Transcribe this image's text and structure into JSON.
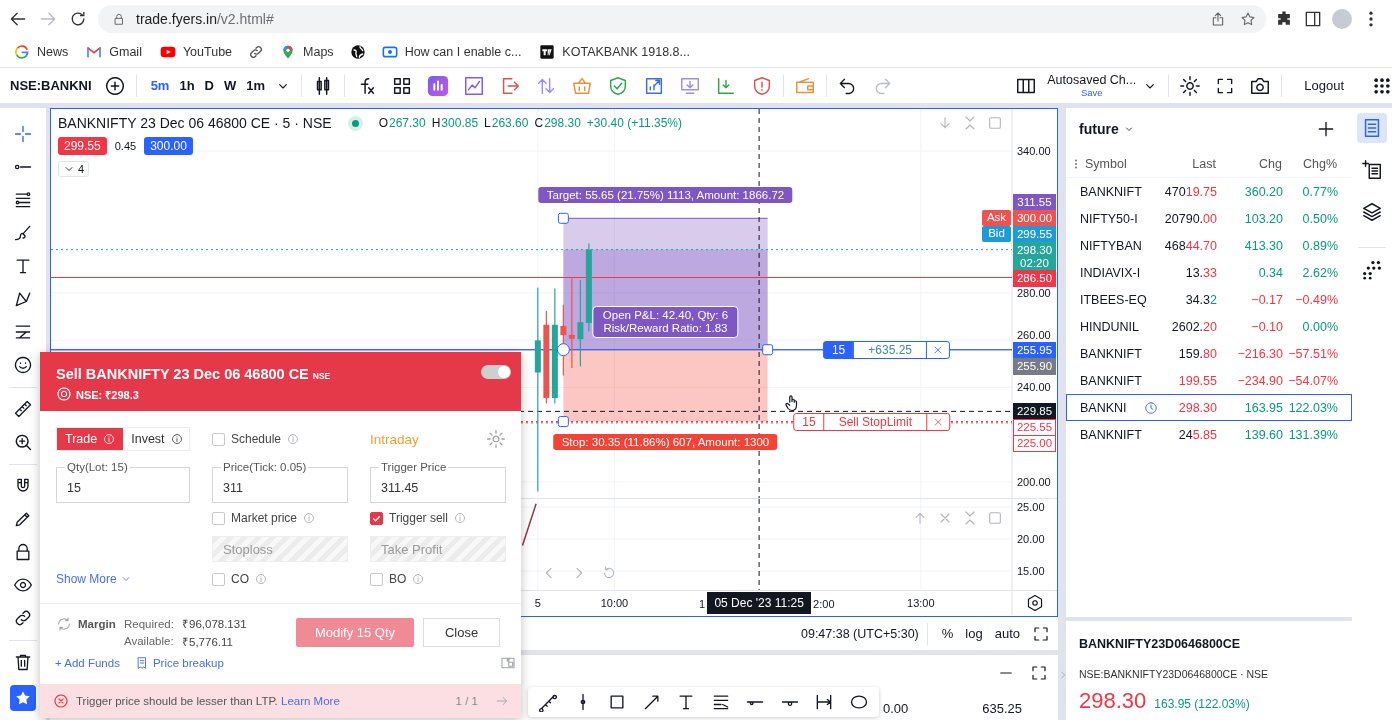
{
  "browser": {
    "url_host": "trade.fyers.in",
    "url_path": "/v2.html#",
    "bookmarks": [
      {
        "label": "News"
      },
      {
        "label": "Gmail"
      },
      {
        "label": "YouTube"
      },
      {
        "label": "Maps"
      },
      {
        "label": "How can I enable c..."
      },
      {
        "label": "KOTAKBANK 1918.8..."
      }
    ]
  },
  "toolbar": {
    "symbol": "NSE:BANKNI",
    "intervals": [
      {
        "label": "5m",
        "selected": true
      },
      {
        "label": "1h",
        "selected": false
      },
      {
        "label": "D",
        "selected": false
      },
      {
        "label": "W",
        "selected": false
      },
      {
        "label": "1m",
        "selected": false
      }
    ],
    "layout_name": "Autosaved Ch...",
    "save": "Save",
    "logout": "Logout"
  },
  "left_tools": [
    {
      "selected": true
    },
    {
      "selected": false
    },
    {
      "selected": false
    },
    {
      "selected": false
    },
    {
      "selected": false
    },
    {
      "selected": false
    },
    {
      "selected": false
    },
    {
      "selected": false
    },
    {
      "selected": false
    },
    {
      "selected": false
    },
    {
      "selected": false
    },
    {
      "selected": false
    },
    {
      "selected": false
    },
    {
      "selected": false
    },
    {
      "selected": false
    },
    {
      "selected": false
    },
    {
      "selected": true
    }
  ],
  "chart": {
    "title": "BANKNIFTY 23 Dec 06 46800 CE · 5 · NSE",
    "legend": [
      {
        "key": "O",
        "value": "267.30"
      },
      {
        "key": "H",
        "value": "300.85"
      },
      {
        "key": "L",
        "value": "263.60"
      },
      {
        "key": "C",
        "value": "298.30"
      }
    ],
    "change": "+30.40 (+11.35%)",
    "sell_price": "299.55",
    "spread": "0.45",
    "buy_price": "300.00",
    "indicator_count": "4",
    "price_tags": [
      {
        "kind": "filled"
      },
      {
        "kind": "filled",
        "second_line": "02:20"
      },
      {
        "kind": "filled"
      },
      {
        "kind": "filled",
        "order": {
          "qty": "15",
          "text": "+635.25"
        }
      },
      {
        "kind": "filled"
      },
      {
        "kind": "filled"
      },
      {
        "kind": "outline",
        "order": {
          "qty": "15",
          "text": "Sell StopLimit"
        }
      },
      {
        "kind": "outline"
      }
    ],
    "quote_tags": [
      {
        "label": "300.00",
        "side_label": "Ask",
        "color": "#ef5350"
      },
      {
        "label": "299.55",
        "side_label": "Bid",
        "color": "#1e9ad6"
      }
    ],
    "covered_time_labels": [
      "1",
      "2:00"
    ],
    "chart_data": [
      {
        "type": "candlestick",
        "x": [
          "2023-12-05T09:15",
          "2023-12-05T09:20",
          "2023-12-05T09:25",
          "2023-12-05T09:30",
          "2023-12-05T09:35",
          "2023-12-05T09:40",
          "2023-12-05T09:45"
        ],
        "ohlc": [
          [
            246.3,
            282.2,
            196,
            259.9
          ],
          [
            266.5,
            272.3,
            233.2,
            235.5
          ],
          [
            235.5,
            281.8,
            233.2,
            266.5
          ],
          [
            266,
            275,
            245,
            262.1
          ],
          [
            262.2,
            286.2,
            248.2,
            260.6
          ],
          [
            260.4,
            285.4,
            249,
            267.6
          ],
          [
            267.3,
            300.85,
            263.6,
            298.3
          ]
        ],
        "xlim": [
          "2023-12-05T04:29",
          "2023-12-05T14:20"
        ],
        "ylim": [
          193.2,
          357.8
        ],
        "tick_labels": "y",
        "grid": true,
        "yticks": [
          {
            "value": 340,
            "label": "340.00"
          },
          {
            "value": 280,
            "label": "280.00"
          },
          {
            "value": 260,
            "label": "260.00"
          },
          {
            "value": 240,
            "label": "240.00"
          },
          {
            "value": 200,
            "label": "200.00"
          }
        ],
        "ref_lines": [
          {
            "axis": "y",
            "value": 311.55,
            "label": "311.55",
            "color": "#7e57c2",
            "line_style": "solid"
          },
          {
            "axis": "y",
            "value": 298.3,
            "label": "298.30",
            "color": "#26a69a",
            "line_style": "dotted"
          },
          {
            "axis": "y",
            "value": 286.5,
            "label": "286.50",
            "color": "#f23645",
            "line_style": "solid"
          },
          {
            "axis": "y",
            "value": 255.95,
            "label": "255.95",
            "color": "#2962ff",
            "line_style": "solid"
          },
          {
            "axis": "y",
            "value": 255.9,
            "label": "255.90",
            "color": "#787b86",
            "line_style": "solid"
          },
          {
            "axis": "y",
            "value": 229.85,
            "label": "229.85",
            "color": "#131722",
            "line_style": "dashed"
          },
          {
            "axis": "y",
            "value": 225.55,
            "label": "225.55",
            "color": "#f23645",
            "line_style": "dotted"
          },
          {
            "axis": "y",
            "value": 225,
            "label": "225.00",
            "color": "#f23645",
            "line_style": "dotted"
          },
          {
            "axis": "x",
            "value": "2023-12-05T11:25",
            "color": "#131722",
            "line_style": "dashed"
          }
        ],
        "bands": [
          {
            "axis": "y",
            "from": 255.95,
            "to": 311.55,
            "label": "Target: 55.65 (21.75%) 1113, Amount: 1866.72",
            "color": "#7e57c2"
          },
          {
            "axis": "y",
            "from": 225.55,
            "to": 255.95,
            "label": "Stop: 30.35 (11.86%) 607, Amount: 1300",
            "color": "#f44336"
          }
        ],
        "annotations": [
          "Open P&L: 42.40, Qty: 6",
          "Risk/Reward Ratio: 1.83"
        ]
      },
      {
        "type": "line",
        "x": [
          "2023-12-05T09:06",
          "2023-12-05T09:14"
        ],
        "values": [
          19,
          25.5
        ],
        "color": "#8d3a4a",
        "xlim": [
          "2023-12-05T04:29",
          "2023-12-05T14:20"
        ],
        "ylim": [
          12.2,
          26.25
        ],
        "grid": true,
        "yticks": [
          {
            "value": 25,
            "label": "25.00"
          },
          {
            "value": 20,
            "label": "20.00"
          },
          {
            "value": 15,
            "label": "15.00"
          }
        ],
        "xticks": [
          {
            "value": "2023-12-05T09:15",
            "label": "5"
          },
          {
            "value": "2023-12-05T10:00",
            "label": "10:00"
          },
          {
            "value": "2023-12-05T13:00",
            "label": "13:00"
          }
        ],
        "ref_lines": [
          {
            "axis": "x",
            "value": "2023-12-05T11:25",
            "label": "05 Dec '23 11:25",
            "color": "#131722",
            "line_style": "dashed"
          }
        ]
      }
    ]
  },
  "chart_footer": {
    "time": "09:47:38 (UTC+5:30)",
    "percent": "%",
    "log": "log",
    "auto": "auto"
  },
  "bottom_panel": {
    "values": [
      "0.00",
      "635.25"
    ]
  },
  "order_ticket": {
    "title": "Sell BANKNIFTY 23 Dec 06 46800 CE",
    "exchange": "NSE",
    "ltp": "NSE: ₹298.3",
    "toggle": {
      "on": true
    },
    "modes": [
      {
        "label": "Trade",
        "selected": true
      },
      {
        "label": "Invest",
        "selected": false
      }
    ],
    "schedule": {
      "label": "Schedule",
      "checked": false
    },
    "product": "Intraday",
    "fields": [
      {
        "label": "Qty(Lot: 15)",
        "value": "15"
      },
      {
        "label": "Price(Tick: 0.05)",
        "value": "311"
      },
      {
        "label": "Trigger Price",
        "value": "311.45"
      }
    ],
    "options": [
      {
        "label": "Market price",
        "checked": false
      },
      {
        "label": "Trigger sell",
        "checked": true
      }
    ],
    "exit_fields": [
      {
        "placeholder": "Stoploss",
        "disabled": true
      },
      {
        "placeholder": "Take Profit",
        "disabled": true
      }
    ],
    "show_more": "Show More",
    "order_types": [
      {
        "label": "CO",
        "checked": false
      },
      {
        "label": "BO",
        "checked": false
      }
    ],
    "margin": {
      "label": "Margin",
      "required_label": "Required:",
      "required": "₹96,078.131",
      "available_label": "Available:",
      "available": "₹5,776.11"
    },
    "submit": {
      "label": "Modify 15 Qty",
      "disabled": true
    },
    "close": "Close",
    "add_funds": "+ Add Funds",
    "price_breakup": "Price breakup",
    "error": {
      "text": "Trigger price should be lesser than LTP.",
      "link": "Learn More",
      "counter": "1 / 1"
    }
  },
  "watchlist": {
    "name": "future",
    "columns": [
      "Symbol",
      "Last",
      "Chg",
      "Chg%"
    ],
    "rows": [
      {
        "symbol": "BANKNIFT",
        "last": "470",
        "last_tick": "19.75",
        "tick_up": false,
        "chg": "360.20",
        "chg_pct": "0.77%",
        "chg_up": true,
        "pct_up": true,
        "selected": false
      },
      {
        "symbol": "NIFTY50-I",
        "last": "20790.",
        "last_tick": "00",
        "tick_up": false,
        "chg": "103.20",
        "chg_pct": "0.50%",
        "chg_up": true,
        "pct_up": true,
        "selected": false
      },
      {
        "symbol": "NIFTYBAN",
        "last": "468",
        "last_tick": "44.70",
        "tick_up": false,
        "chg": "413.30",
        "chg_pct": "0.89%",
        "chg_up": true,
        "pct_up": true,
        "selected": false
      },
      {
        "symbol": "INDIAVIX-I",
        "last": "13.",
        "last_tick": "33",
        "tick_up": false,
        "chg": "0.34",
        "chg_pct": "2.62%",
        "chg_up": true,
        "pct_up": true,
        "selected": false
      },
      {
        "symbol": "ITBEES-EQ",
        "last": "34.3",
        "last_tick": "2",
        "tick_up": true,
        "chg": "−0.17",
        "chg_pct": "−0.49%",
        "chg_up": false,
        "pct_up": false,
        "selected": false
      },
      {
        "symbol": "HINDUNIL",
        "last": "2602.",
        "last_tick": "20",
        "tick_up": false,
        "chg": "−0.10",
        "chg_pct": "0.00%",
        "chg_up": false,
        "pct_up": true,
        "selected": false
      },
      {
        "symbol": "BANKNIFT",
        "last": "159.",
        "last_tick": "80",
        "tick_up": false,
        "chg": "−216.30",
        "chg_pct": "−57.51%",
        "chg_up": false,
        "pct_up": false,
        "selected": false
      },
      {
        "symbol": "BANKNIFT",
        "last_tick": "199.55",
        "tick_up": false,
        "chg": "−234.90",
        "chg_pct": "−54.07%",
        "chg_up": false,
        "pct_up": false,
        "selected": false
      },
      {
        "symbol": "BANKNI",
        "last_tick": "298.30",
        "tick_up": false,
        "chg": "163.95",
        "chg_pct": "122.03%",
        "chg_up": true,
        "pct_up": true,
        "selected": true
      },
      {
        "symbol": "BANKNIFT",
        "last": "24",
        "last_tick": "5.85",
        "tick_up": false,
        "chg": "139.60",
        "chg_pct": "131.39%",
        "chg_up": true,
        "pct_up": true,
        "selected": false
      }
    ]
  },
  "right_tools": [
    {
      "selected": true
    },
    {
      "selected": false
    },
    {
      "selected": false
    },
    {
      "selected": false
    }
  ],
  "symbol_info": {
    "name": "BANKNIFTY23D0646800CE",
    "exchange": "NSE:BANKNIFTY23D0646800CE · NSE",
    "price": "298.30",
    "change": "163.95 (122.03%)"
  }
}
